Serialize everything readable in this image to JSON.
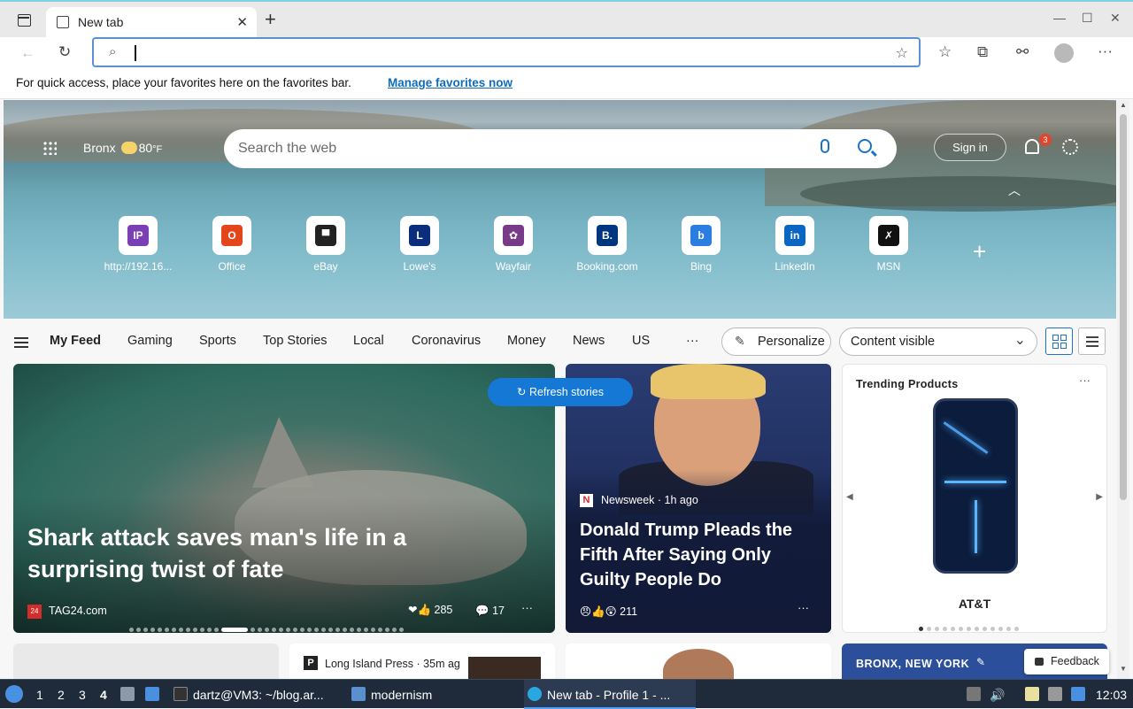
{
  "browser": {
    "tab_title": "New tab",
    "tab_close": "✕",
    "new_tab": "+",
    "window_controls": [
      "—",
      "☐",
      "✕"
    ],
    "address_value": "",
    "favorites_message": "For quick access, place your favorites here on the favorites bar.",
    "favorites_link": "Manage favorites now"
  },
  "hero": {
    "location": "Bronx",
    "temperature": "80",
    "temp_unit": "°F",
    "search_placeholder": "Search the web",
    "sign_in": "Sign in",
    "notification_count": "3",
    "quick_links": [
      {
        "label": "http://192.16...",
        "glyph": "IP",
        "color": "#7b3fb5"
      },
      {
        "label": "Office",
        "glyph": "O",
        "color": "#e3461b"
      },
      {
        "label": "eBay",
        "glyph": "▀",
        "color": "#222222"
      },
      {
        "label": "Lowe's",
        "glyph": "L",
        "color": "#0c2c7d"
      },
      {
        "label": "Wayfair",
        "glyph": "✿",
        "color": "#7a3a8a"
      },
      {
        "label": "Booking.com",
        "glyph": "B.",
        "color": "#003580"
      },
      {
        "label": "Bing",
        "glyph": "b",
        "color": "#2a7de1"
      },
      {
        "label": "LinkedIn",
        "glyph": "in",
        "color": "#0a66c2"
      },
      {
        "label": "MSN",
        "glyph": "✗",
        "color": "#111111"
      }
    ]
  },
  "feed_nav": {
    "items": [
      "My Feed",
      "Gaming",
      "Sports",
      "Top Stories",
      "Local",
      "Coronavirus",
      "Money",
      "News",
      "US"
    ],
    "more": "···",
    "personalize": "Personalize",
    "content_visibility": "Content visible"
  },
  "cards": {
    "refresh": "Refresh stories",
    "main": {
      "headline": "Shark attack saves man's life in a surprising twist of fate",
      "source": "TAG24.com",
      "source_icon": "24",
      "reactions": "285",
      "reaction_emoji": "❤👍",
      "comments": "17",
      "more": "···"
    },
    "second": {
      "source": "Newsweek · 1h ago",
      "source_icon": "N",
      "headline": "Donald Trump Pleads the Fifth After Saying Only Guilty People Do",
      "reactions": "211",
      "reaction_emoji": "😠👍😲",
      "more": "···"
    },
    "trending": {
      "title": "Trending Products",
      "brand": "AT&T",
      "more": "···"
    },
    "row2": {
      "b_source": "Long Island Press · 35m ag",
      "b_icon": "P",
      "d_title": "BRONX, NEW YORK"
    },
    "feedback": "Feedback"
  },
  "taskbar": {
    "workspaces": [
      "1",
      "2",
      "3",
      "4"
    ],
    "terminal": "dartz@VM3: ~/blog.ar...",
    "folder": "modernism",
    "browser": "New tab - Profile 1 - ...",
    "clock": "12:03"
  }
}
